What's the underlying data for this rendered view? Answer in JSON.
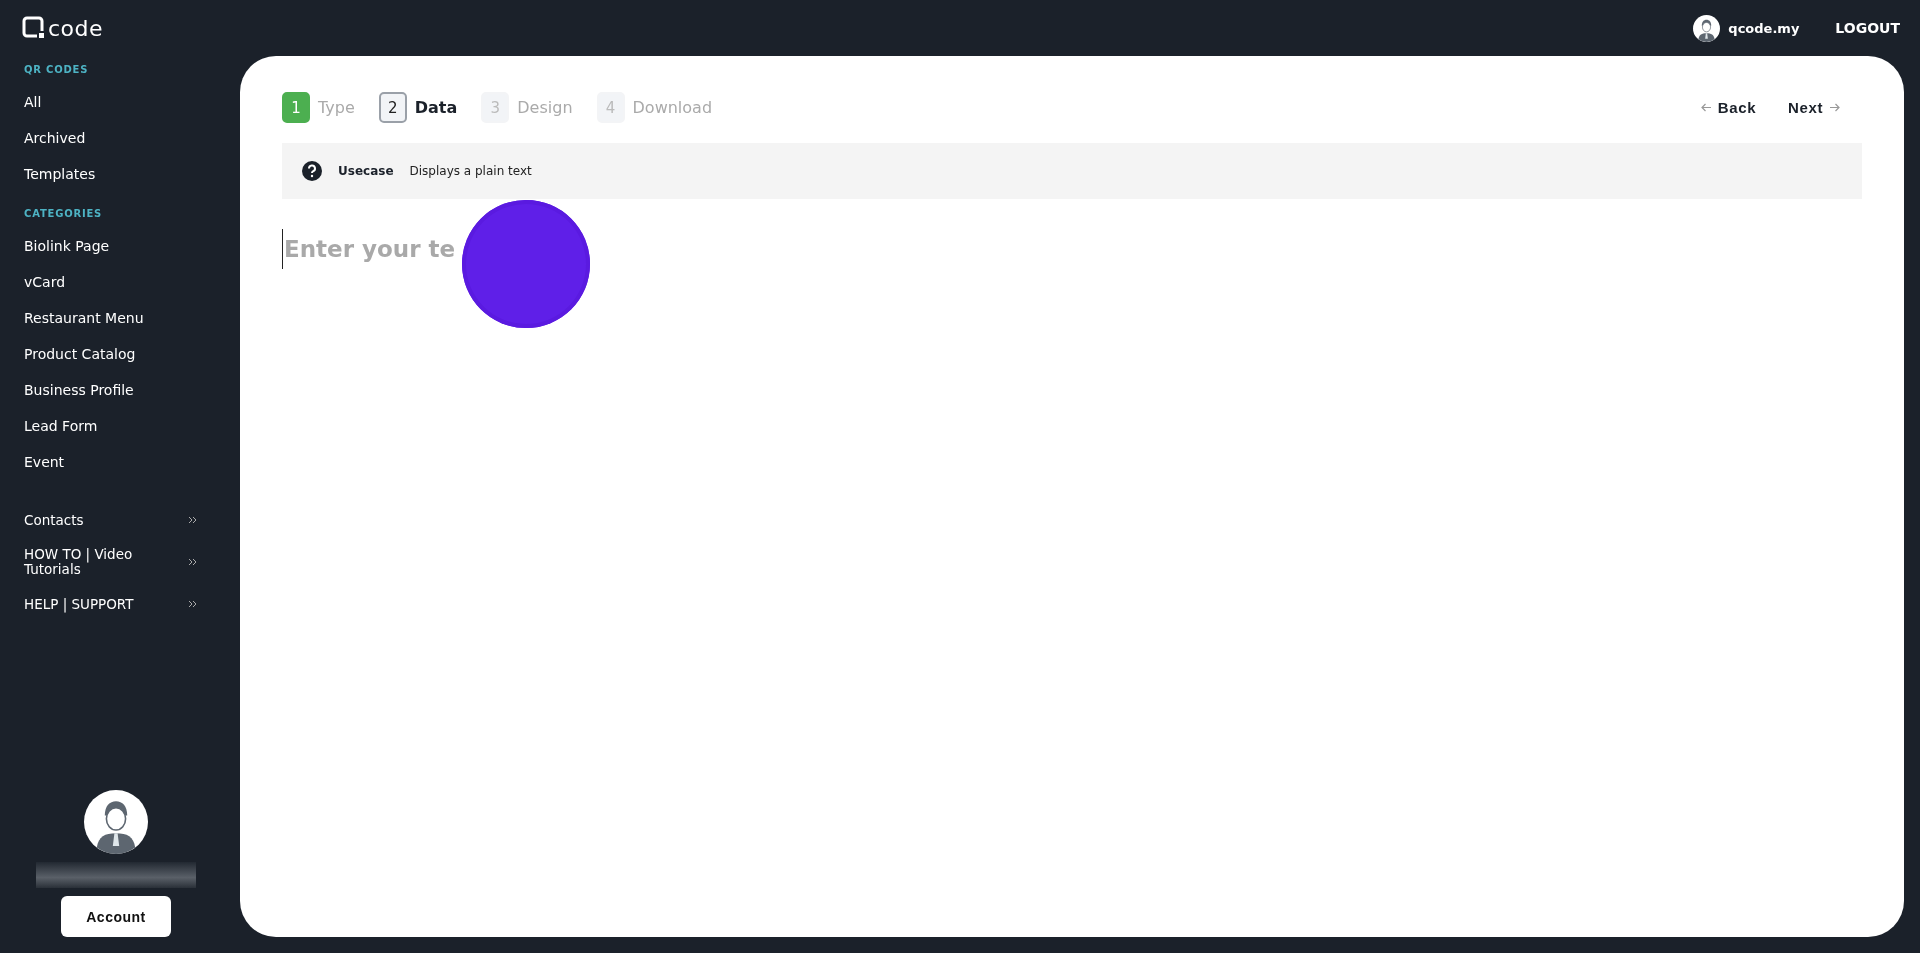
{
  "header": {
    "logo": "code",
    "username": "qcode.my",
    "logout": "LOGOUT"
  },
  "sidebar": {
    "sections": [
      {
        "title": "QR CODES",
        "items": [
          "All",
          "Archived",
          "Templates"
        ]
      },
      {
        "title": "CATEGORIES",
        "items": [
          "Biolink Page",
          "vCard",
          "Restaurant Menu",
          "Product Catalog",
          "Business Profile",
          "Lead Form",
          "Event"
        ]
      }
    ],
    "links": [
      "Contacts",
      "HOW TO | Video Tutorials",
      "HELP | SUPPORT"
    ],
    "account_button": "Account"
  },
  "steps": [
    {
      "number": "1",
      "label": "Type",
      "completed": true,
      "selected": false
    },
    {
      "number": "2",
      "label": "Data",
      "completed": false,
      "selected": true
    },
    {
      "number": "3",
      "label": "Design",
      "completed": false,
      "selected": false
    },
    {
      "number": "4",
      "label": "Download",
      "completed": false,
      "selected": false
    }
  ],
  "nav": {
    "back": "Back",
    "next": "Next"
  },
  "usecase": {
    "label": "Usecase",
    "text": "Displays a plain text"
  },
  "text_input": {
    "placeholder": "Enter your te"
  }
}
